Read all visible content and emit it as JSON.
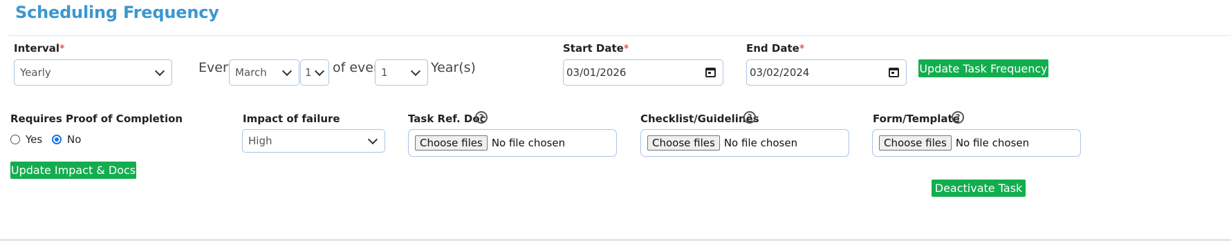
{
  "page": {
    "title": "Scheduling Frequency"
  },
  "schedule": {
    "interval_label": "Interval",
    "interval_value": "Yearly",
    "every_text": "Every",
    "month_value": "March",
    "day_value": "1",
    "of_every_text": "of every",
    "years_value": "1",
    "years_suffix": "Year(s)",
    "start_date_label": "Start Date",
    "start_date_value": "03/01/2026",
    "end_date_label": "End Date",
    "end_date_value": "03/02/2024",
    "required_mark": "*",
    "update_frequency_button": "Update Task Frequency"
  },
  "details": {
    "proof_label": "Requires Proof of Completion",
    "proof_options": [
      {
        "label": "Yes",
        "selected": false
      },
      {
        "label": "No",
        "selected": true
      }
    ],
    "impact_label": "Impact of failure",
    "impact_value": "High",
    "task_ref_label": "Task Ref. Doc",
    "checklist_label": "Checklist/Guidelines",
    "form_label": "Form/Template",
    "help_glyph": "?",
    "choose_files": "Choose files",
    "no_file": "No file chosen",
    "update_impact_button": "Update Impact & Docs",
    "deactivate_button": "Deactivate Task"
  },
  "colors": {
    "title": "#3b97d0",
    "button_green": "#13ad4f",
    "required_red": "#e02020",
    "radio_blue": "#1a73e8",
    "field_border": "#aac4e4"
  }
}
